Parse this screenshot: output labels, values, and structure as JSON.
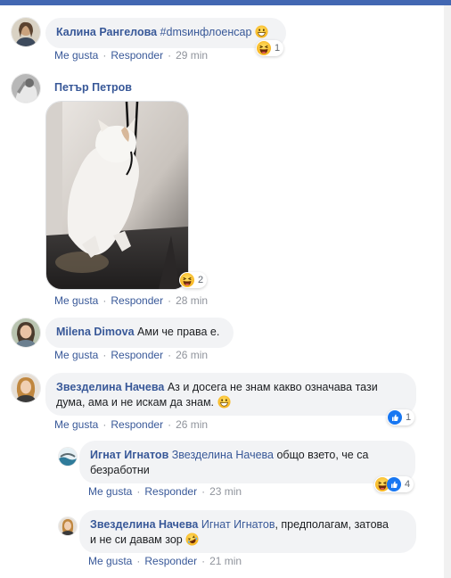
{
  "comments": [
    {
      "author": "Калина Рангелова",
      "text": "#dmsинфлоенсар",
      "reaction_count": "1",
      "actions": {
        "like": "Me gusta",
        "reply": "Responder",
        "time": "29 min"
      }
    },
    {
      "author": "Петър Петров",
      "image_alt": "white cat photo",
      "reaction_count": "2",
      "actions": {
        "like": "Me gusta",
        "reply": "Responder",
        "time": "28 min"
      }
    },
    {
      "author": "Milena Dimova",
      "text": "Ами че права е.",
      "actions": {
        "like": "Me gusta",
        "reply": "Responder",
        "time": "26 min"
      }
    },
    {
      "author": "Звезделина Начева",
      "text_line1": "Аз и досега не знам какво означава тази",
      "text_line2": "дума, ама и не искам да знам.",
      "reaction_count": "1",
      "actions": {
        "like": "Me gusta",
        "reply": "Responder",
        "time": "26 min"
      }
    }
  ],
  "replies": [
    {
      "author": "Игнат Игнатов",
      "mention": "Звезделина Начева",
      "text_line1": "общо взето, че са",
      "text_line2": "безработни",
      "reaction_count": "4",
      "actions": {
        "like": "Me gusta",
        "reply": "Responder",
        "time": "23 min"
      }
    },
    {
      "author": "Звезделина Начева",
      "mention": "Игнат Игнатов",
      "text_line1": ", предполагам, затова",
      "text_line2": "и не си давам зор",
      "actions": {
        "like": "Me gusta",
        "reply": "Responder",
        "time": "21 min"
      }
    }
  ],
  "colors": {
    "link": "#385898",
    "bubble": "#f2f3f5",
    "meta": "#90949c",
    "like_blue": "#1877f2"
  }
}
